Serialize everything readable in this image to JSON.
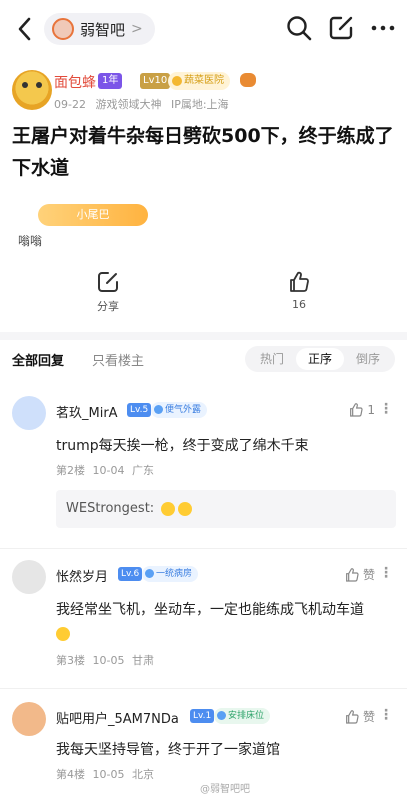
{
  "topbar": {
    "forum_name": "弱智吧",
    "forum_chevron": ">"
  },
  "author": {
    "name": "面包蜂",
    "fan_level": "1年",
    "lv": "Lv10",
    "honor": "蔬菜医院",
    "date": "09-22",
    "title_badge": "游戏领域大神",
    "ip": "IP属地:上海"
  },
  "post": {
    "title": "王屠户对着牛杂每日劈砍500下，终于练成了下水道",
    "tail_tag": "小尾巴",
    "body": "嗡嗡"
  },
  "actions": {
    "share_label": "分享",
    "like_count": "16"
  },
  "tabs": {
    "all": "全部回复",
    "host_only": "只看楼主",
    "sort_hot": "热门",
    "sort_order": "正序",
    "sort_reverse": "倒序"
  },
  "comments": [
    {
      "name": "茗玖_MirA",
      "lv": "Lv.5",
      "badge": "便气外露",
      "likes": "1",
      "text": "trump每天挨一枪，终于变成了绵木千束",
      "floor": "第2楼",
      "date": "10-04",
      "location": "广东",
      "reply": "WEStrongest:"
    },
    {
      "name": "怅然岁月",
      "lv": "Lv.6",
      "badge": "一统病房",
      "likes": "赞",
      "text": "我经常坐飞机，坐动车，一定也能练成飞机动车道",
      "floor": "第3楼",
      "date": "10-05",
      "location": "甘肃"
    },
    {
      "name": "贴吧用户_5AM7NDa",
      "lv": "Lv.1",
      "badge": "安排床位",
      "likes": "赞",
      "text": "我每天坚持导管，终于开了一家道馆",
      "floor": "第4楼",
      "date": "10-05",
      "location": "北京"
    }
  ],
  "watermark": "@弱智吧吧"
}
